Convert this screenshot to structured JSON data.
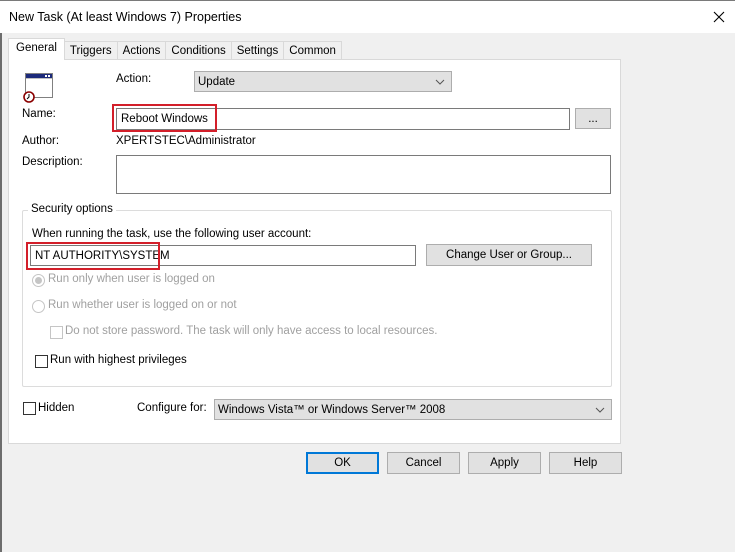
{
  "window": {
    "title": "New Task (At least Windows 7) Properties",
    "close_icon": "close-icon"
  },
  "tabs": [
    {
      "label": "General",
      "active": true
    },
    {
      "label": "Triggers",
      "active": false
    },
    {
      "label": "Actions",
      "active": false
    },
    {
      "label": "Conditions",
      "active": false
    },
    {
      "label": "Settings",
      "active": false
    },
    {
      "label": "Common",
      "active": false
    }
  ],
  "general": {
    "task_icon": "scheduled-task-icon",
    "action_label": "Action:",
    "action_value": "Update",
    "name_label": "Name:",
    "name_value": "Reboot Windows",
    "browse_label": "...",
    "author_label": "Author:",
    "author_value": "XPERTSTEC\\Administrator",
    "description_label": "Description:",
    "description_value": ""
  },
  "security": {
    "group_title": "Security options",
    "account_prompt": "When running the task, use the following user account:",
    "account_value": "NT AUTHORITY\\SYSTEM",
    "change_user_label": "Change User or Group...",
    "radio_logged_on": {
      "label": "Run only when user is logged on",
      "checked": true,
      "disabled": true
    },
    "radio_whether": {
      "label": "Run whether user is logged on or not",
      "checked": false,
      "disabled": true
    },
    "no_store_password": {
      "label": "Do not store password.  The task will only have access to local resources.",
      "checked": false,
      "disabled": true
    },
    "highest_privileges": {
      "label": "Run with highest privileges",
      "checked": false
    }
  },
  "bottom": {
    "hidden_label": "Hidden",
    "hidden_checked": false,
    "configure_label": "Configure for:",
    "configure_value": "Windows Vista™ or Windows Server™ 2008"
  },
  "buttons": {
    "ok": "OK",
    "cancel": "Cancel",
    "apply": "Apply",
    "help": "Help"
  },
  "colors": {
    "highlight": "#d31f2a",
    "default_button_border": "#0078d7"
  }
}
